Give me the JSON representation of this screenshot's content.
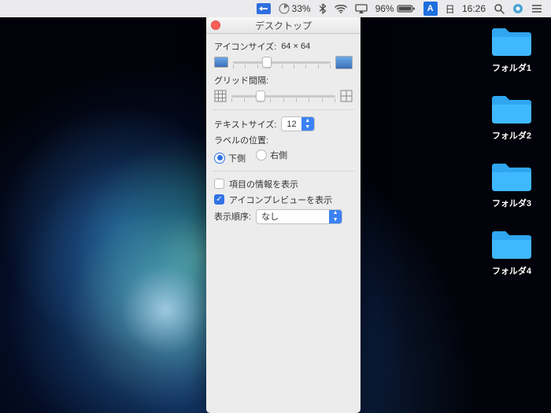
{
  "menubar": {
    "percent1": "33%",
    "battery": "96%",
    "ime": "A",
    "day": "日",
    "time": "16:26"
  },
  "folders": [
    "フォルダ1",
    "フォルダ2",
    "フォルダ3",
    "フォルダ4"
  ],
  "win": {
    "title": "デスクトップ",
    "icon_size_label": "アイコンサイズ:",
    "icon_size_value": "64 × 64",
    "icon_slider_percent": 35,
    "grid_label": "グリッド間隔:",
    "grid_slider_percent": 28,
    "text_size_label": "テキストサイズ:",
    "text_size_value": "12",
    "label_pos_label": "ラベルの位置:",
    "radio_bottom": "下側",
    "radio_right": "右側",
    "radio_selected": "bottom",
    "chk_info": "項目の情報を表示",
    "chk_info_checked": false,
    "chk_preview": "アイコンプレビューを表示",
    "chk_preview_checked": true,
    "sort_label": "表示順序:",
    "sort_value": "なし"
  }
}
